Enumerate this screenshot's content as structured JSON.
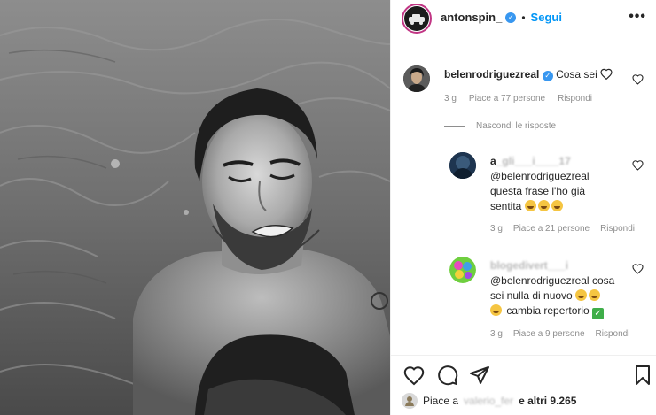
{
  "header": {
    "username": "antonspin_",
    "separator": "•",
    "follow_label": "Segui",
    "more_label": "•••"
  },
  "comments": [
    {
      "username": "belenrodriguezreal",
      "text": "Cosa sei",
      "time": "3 g",
      "likes": "Piace a 77 persone",
      "reply": "Rispondi"
    }
  ],
  "hide_replies_label": "Nascondi le risposte",
  "replies": [
    {
      "username": "a",
      "username_obscured": "_gli___i____17",
      "mention": "@belenrodriguezreal",
      "text_line1": "questa frase l'ho già",
      "text_line2": "sentita",
      "emoji_count": 3,
      "time": "3 g",
      "likes": "Piace a 21 persone",
      "reply": "Rispondi"
    },
    {
      "username": "blogedivert___i",
      "mention": "@belenrodriguezreal",
      "text_line1": "cosa",
      "text_line2": "sei nulla di nuovo",
      "text_line3": "cambia repertorio",
      "check": "✓",
      "time": "3 g",
      "likes": "Piace a 9 persone",
      "reply": "Rispondi"
    }
  ],
  "footer": {
    "likes_prefix": "Piace a",
    "likes_obscured": "valerio_fer",
    "likes_suffix": "e altri 9.265"
  },
  "colors": {
    "accent": "#0095f6",
    "verified": "#3897f0",
    "text_secondary": "#8e8e8e"
  },
  "icons": [
    "heart-icon",
    "comment-icon",
    "share-icon",
    "bookmark-icon",
    "verified-icon",
    "more-icon"
  ]
}
